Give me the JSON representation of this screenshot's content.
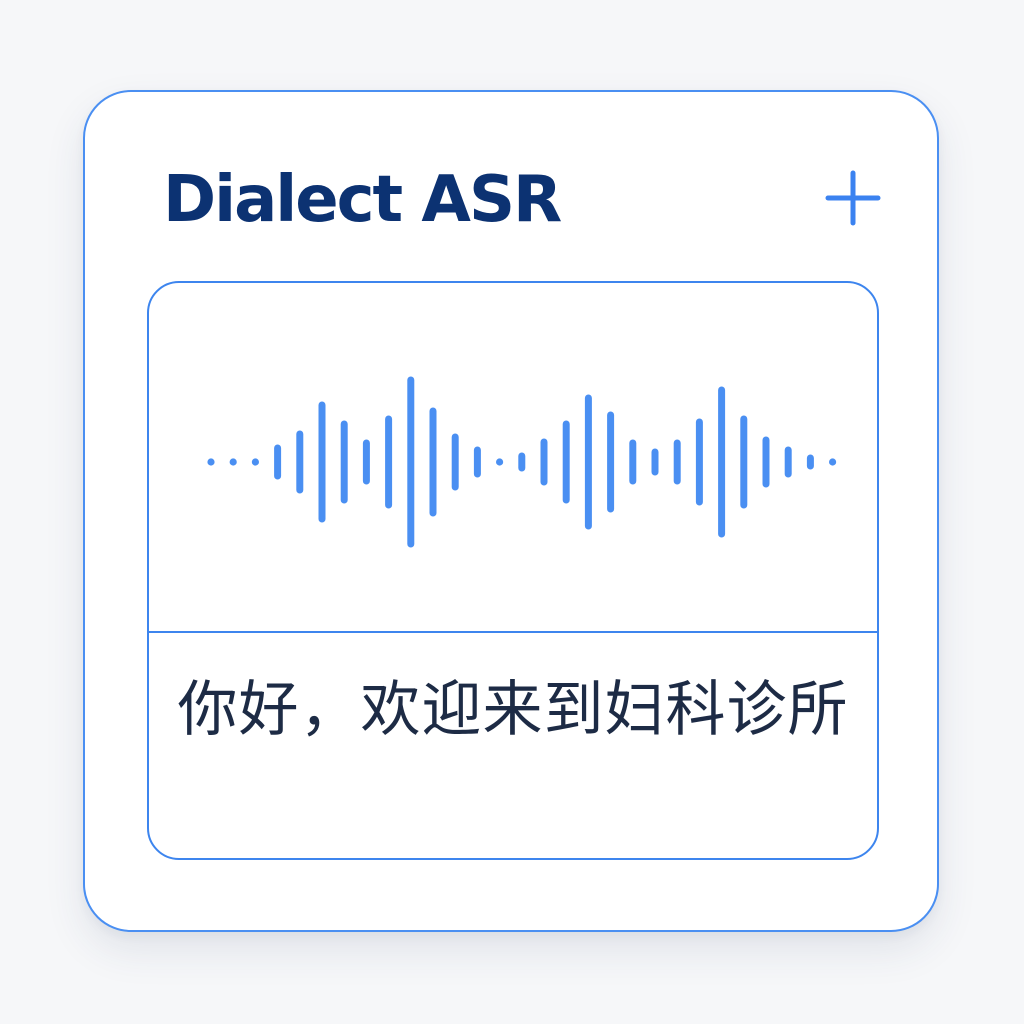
{
  "app": {
    "title": "Dialect ASR"
  },
  "toolbar": {
    "add_icon": "plus-icon"
  },
  "recorder": {
    "waveform_icon": "audio-waveform-icon",
    "accent_color": "#3d85ee"
  },
  "transcript": {
    "text": "你好，欢迎来到妇科诊所"
  },
  "colors": {
    "title": "#0c3272",
    "border": "#4a8ff2",
    "waveform": "#4a8ff2",
    "text": "#1d2b45",
    "background": "#f6f7f9"
  }
}
